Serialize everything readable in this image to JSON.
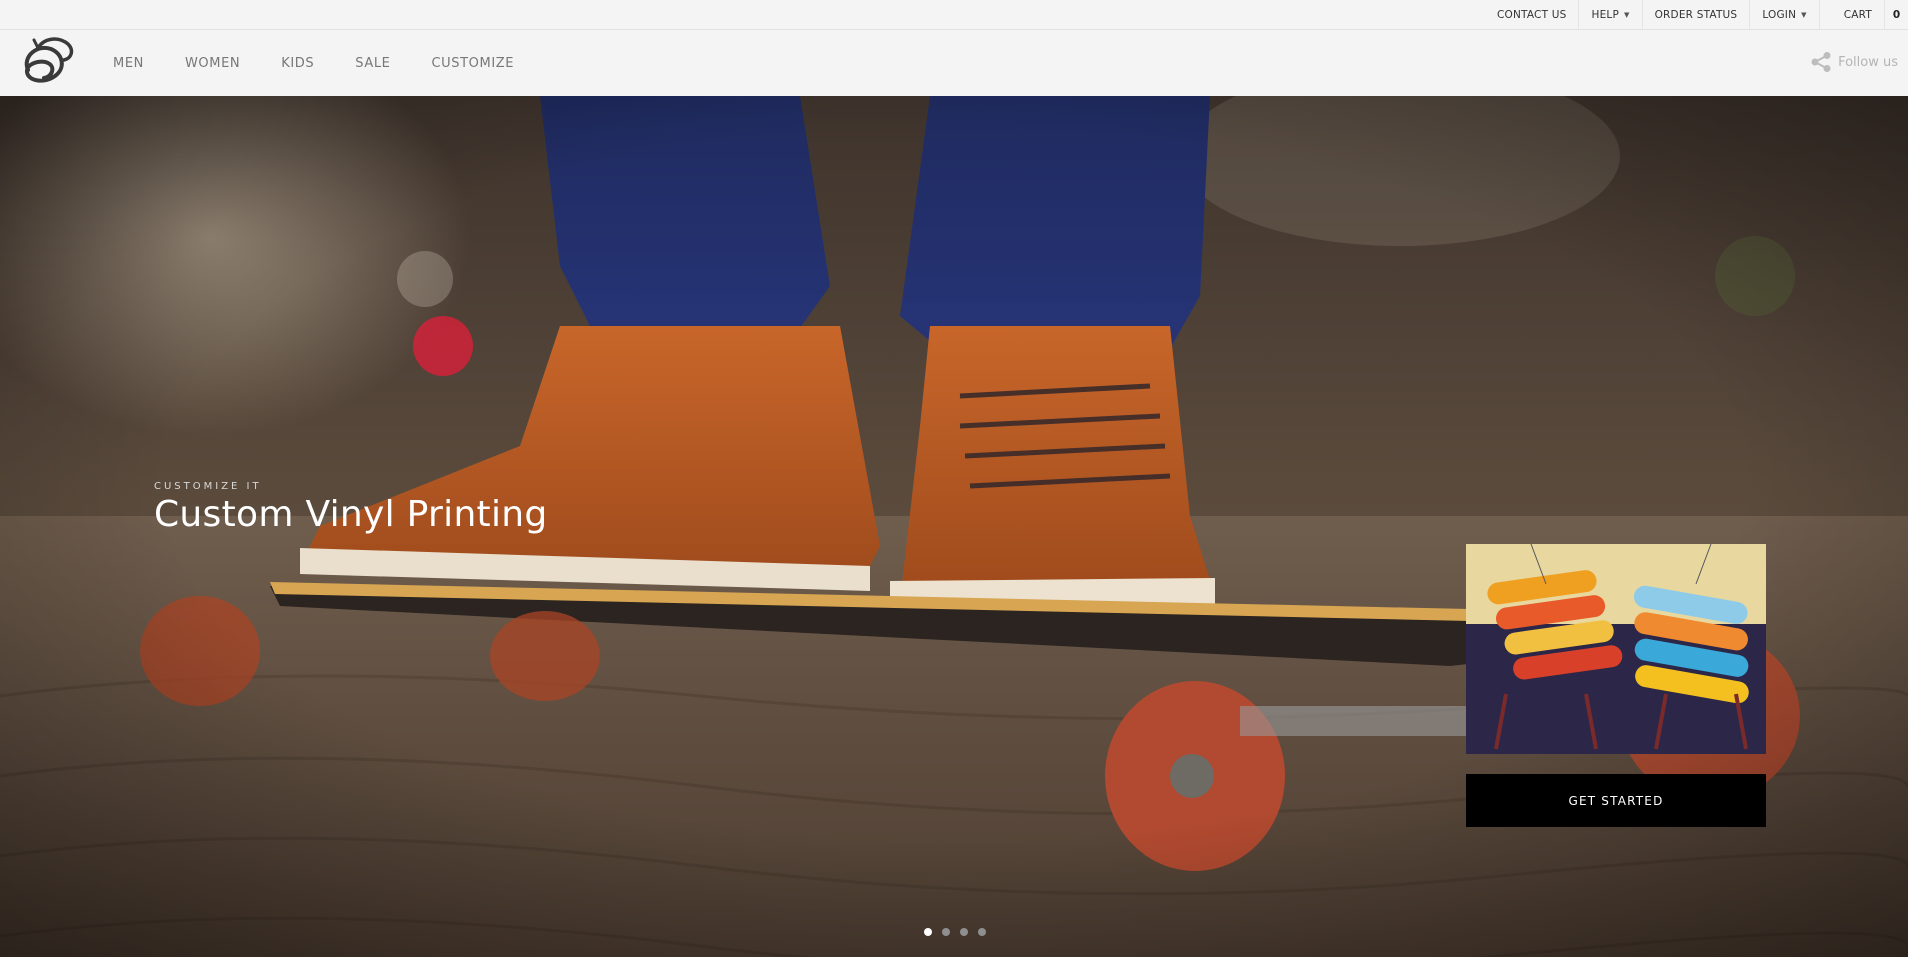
{
  "utility_bar": {
    "links": [
      {
        "label": "CONTACT US"
      },
      {
        "label": "HELP",
        "caret": "⌄"
      },
      {
        "label": "ORDER STATUS"
      },
      {
        "label": "LOGIN",
        "caret": "⌄"
      }
    ],
    "cart_label": "CART",
    "cart_count": "0"
  },
  "nav": {
    "logo_icon": "swirl-logo-icon",
    "items": [
      "MEN",
      "WOMEN",
      "KIDS",
      "SALE",
      "CUSTOMIZE"
    ],
    "follow_us": "Follow us",
    "follow_icon": "share-icon"
  },
  "hero": {
    "eyebrow": "CUSTOMIZE IT",
    "title": "Custom Vinyl Printing",
    "background_image": "sneakers on longboard photo",
    "promo_image": "skateboard decks display photo",
    "cta_label": "GET STARTED",
    "slides_total": 4,
    "active_slide": 1
  },
  "colors": {
    "nav_background": "#f4f4f4",
    "cta_background": "#000000",
    "hero_text": "#ffffff"
  }
}
